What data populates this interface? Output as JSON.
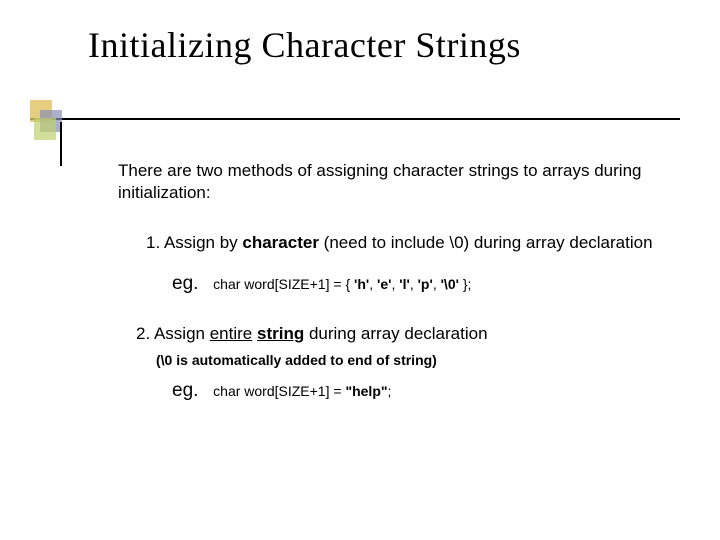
{
  "title": "Initializing Character Strings",
  "intro": "There are two methods of assigning character strings to arrays during initialization:",
  "item1_prefix": "1. Assign by ",
  "item1_keyword": "character",
  "item1_suffix": " (need to include \\0) during array declaration",
  "eg_label": "eg.",
  "code1_lead": "char word[SIZE+1] = { ",
  "code1_c1": "'h'",
  "code1_c2": "'e'",
  "code1_c3": "'l'",
  "code1_c4": "'p'",
  "code1_c5": "'\\0'",
  "code1_tail": " };",
  "comma": ", ",
  "item2_prefix": "2. Assign ",
  "item2_kw1": "entire",
  "item2_sp": " ",
  "item2_kw2": "string",
  "item2_suffix": " during array declaration",
  "note_open": "(",
  "note_kw": "\\0",
  "note_rest": " is automatically added to end of string)",
  "code2_lead": "char word[SIZE+1] = ",
  "code2_str": "\"help\"",
  "code2_tail": ";"
}
